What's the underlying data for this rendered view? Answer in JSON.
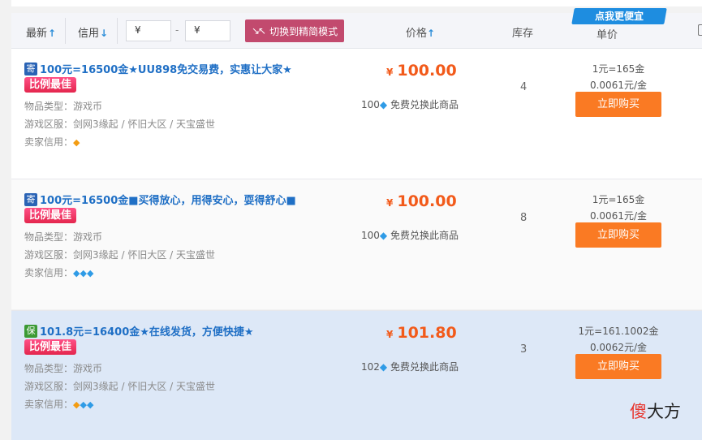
{
  "header": {
    "sort_latest": "最新",
    "sort_credit": "信用",
    "price_min_symbol": "¥",
    "price_max_symbol": "¥",
    "range_dash": "-",
    "switch_label": "切换到精简模式",
    "col_price": "价格",
    "col_stock": "库存",
    "col_unit": "单价",
    "promo_badge": "点我更便宜"
  },
  "labels": {
    "best_ratio": "比例最佳",
    "item_type": "物品类型：",
    "server": "游戏区服：",
    "seller_credit": "卖家信用：",
    "exchange_suffix": "免费兑换此商品",
    "buy_button": "立即购买",
    "currency": "¥"
  },
  "listings": [
    {
      "tag": "寄",
      "tag_color": "#2a63b5",
      "title": "100元=16500金★UU898免交易费，实惠让大家★",
      "item_type": "游戏币",
      "server": "剑网3缘起 / 怀旧大区 / 天宝盛世",
      "credit_icons": [
        "orange-diamond-icon"
      ],
      "price": "100.00",
      "exchange_points": "100",
      "stock": "4",
      "unit_rate": "1元=165金",
      "unit_price": "0.0061元/金"
    },
    {
      "tag": "寄",
      "tag_color": "#2a63b5",
      "title": "100元=16500金■买得放心，用得安心，耍得舒心■",
      "item_type": "游戏币",
      "server": "剑网3缘起 / 怀旧大区 / 天宝盛世",
      "credit_icons": [
        "blue-diamond-icon",
        "blue-diamond-icon",
        "blue-diamond-icon"
      ],
      "price": "100.00",
      "exchange_points": "100",
      "stock": "8",
      "unit_rate": "1元=165金",
      "unit_price": "0.0061元/金"
    },
    {
      "tag": "保",
      "tag_color": "#3c9a34",
      "title": "101.8元=16400金★在线发货，方便快捷★",
      "item_type": "游戏币",
      "server": "剑网3缘起 / 怀旧大区 / 天宝盛世",
      "credit_icons": [
        "orange-diamond-icon",
        "blue-diamond-icon",
        "blue-diamond-icon"
      ],
      "price": "101.80",
      "exchange_points": "102",
      "stock": "3",
      "unit_rate": "1元=161.1002金",
      "unit_price": "0.0062元/金"
    }
  ],
  "watermark": {
    "first": "傻",
    "rest": "大方"
  }
}
